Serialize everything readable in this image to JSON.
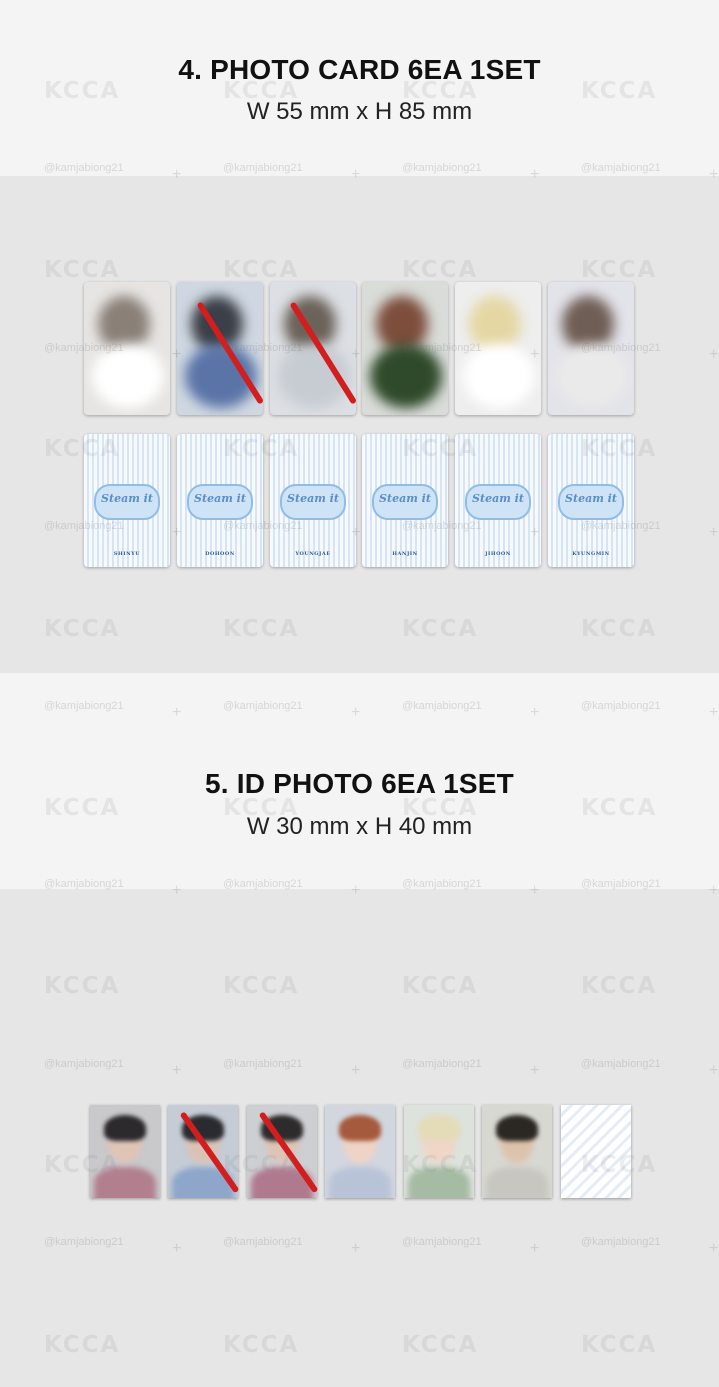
{
  "section4": {
    "title": "4. PHOTO CARD 6EA 1SET",
    "size": "W 55 mm x H 85 mm",
    "front_cards": [
      {
        "name": "photocard-front-1",
        "bg": "#e7e5e3",
        "blobs": [
          "#8a8078",
          "#ffffff"
        ],
        "crossed": false
      },
      {
        "name": "photocard-front-2",
        "bg": "#cfd8e2",
        "blobs": [
          "#3b3f47",
          "#5a74a8"
        ],
        "crossed": true
      },
      {
        "name": "photocard-front-3",
        "bg": "#dcdfe4",
        "blobs": [
          "#6b6259",
          "#c7ccd2"
        ],
        "crossed": true
      },
      {
        "name": "photocard-front-4",
        "bg": "#d9dcd8",
        "blobs": [
          "#7d4e3c",
          "#2f4a2a"
        ],
        "crossed": false
      },
      {
        "name": "photocard-front-5",
        "bg": "#eeeeee",
        "blobs": [
          "#e5d7a4",
          "#ffffff"
        ],
        "crossed": false
      },
      {
        "name": "photocard-front-6",
        "bg": "#e3e3ea",
        "blobs": [
          "#6f5e55",
          "#eaeaea"
        ],
        "crossed": false
      }
    ],
    "back_cards": [
      {
        "member": "SHINYU"
      },
      {
        "member": "DOHOON"
      },
      {
        "member": "YOUNGJAE"
      },
      {
        "member": "HANJIN"
      },
      {
        "member": "JIHOON"
      },
      {
        "member": "KYUNGMIN"
      }
    ],
    "logo_text": "Steam it"
  },
  "section5": {
    "title": "5. ID PHOTO 6EA 1SET",
    "size": "W 30 mm x H 40 mm",
    "id_photos": [
      {
        "bg": "#c9c8cb",
        "hair": "#2c2a2d",
        "skin": "#e0c4b6",
        "shirt": "#b27f8f",
        "crossed": false
      },
      {
        "bg": "#c5ccd6",
        "hair": "#2a2b30",
        "skin": "#dcc2b4",
        "shirt": "#8ea6c9",
        "crossed": true
      },
      {
        "bg": "#cdcfd3",
        "hair": "#2e2b2c",
        "skin": "#dec3b6",
        "shirt": "#b07a8e",
        "crossed": true
      },
      {
        "bg": "#d2d6df",
        "hair": "#a55a3e",
        "skin": "#f0d3c4",
        "shirt": "#b9c3d8",
        "crossed": false
      },
      {
        "bg": "#dde2dc",
        "hair": "#e4dbb8",
        "skin": "#efd6c6",
        "shirt": "#a6bba3",
        "crossed": false
      },
      {
        "bg": "#d8d8d2",
        "hair": "#2b2823",
        "skin": "#ddc3ac",
        "shirt": "#c7c6c0",
        "crossed": false
      }
    ]
  },
  "watermarks": {
    "brand": "KCCA",
    "handle": "@kamjabiong21"
  },
  "colors": {
    "cross_mark": "#d21e1e",
    "card_back_stripe": "#d7e4f3"
  }
}
